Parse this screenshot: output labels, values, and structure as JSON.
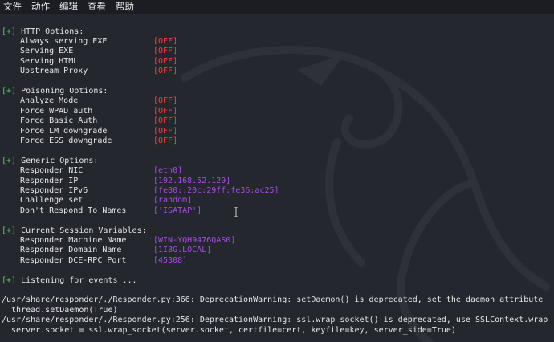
{
  "menu": [
    "文件",
    "动作",
    "编辑",
    "查看",
    "帮助"
  ],
  "tag": "[+]",
  "sections": [
    {
      "title": "HTTP Options:",
      "options": [
        {
          "name": "Always serving EXE",
          "value": "[OFF]",
          "color": "#ff3b3b"
        },
        {
          "name": "Serving EXE",
          "value": "[OFF]",
          "color": "#ff3b3b"
        },
        {
          "name": "Serving HTML",
          "value": "[OFF]",
          "color": "#ff3b3b"
        },
        {
          "name": "Upstream Proxy",
          "value": "[OFF]",
          "color": "#ff3b3b"
        }
      ]
    },
    {
      "title": "Poisoning Options:",
      "options": [
        {
          "name": "Analyze Mode",
          "value": "[OFF]",
          "color": "#ff3b3b"
        },
        {
          "name": "Force WPAD auth",
          "value": "[OFF]",
          "color": "#ff3b3b"
        },
        {
          "name": "Force Basic Auth",
          "value": "[OFF]",
          "color": "#ff3b3b"
        },
        {
          "name": "Force LM downgrade",
          "value": "[OFF]",
          "color": "#ff3b3b"
        },
        {
          "name": "Force ESS downgrade",
          "value": "[OFF]",
          "color": "#ff3b3b"
        }
      ]
    },
    {
      "title": "Generic Options:",
      "options": [
        {
          "name": "Responder NIC",
          "value": "[eth0]",
          "color": "#a54de6"
        },
        {
          "name": "Responder IP",
          "value": "[192.168.52.129]",
          "color": "#a54de6"
        },
        {
          "name": "Responder IPv6",
          "value": "[fe80::20c:29ff:fe36:ac25]",
          "color": "#a54de6"
        },
        {
          "name": "Challenge set",
          "value": "[random]",
          "color": "#a54de6"
        },
        {
          "name": "Don't Respond To Names",
          "value": "['ISATAP']",
          "color": "#a54de6"
        }
      ]
    },
    {
      "title": "Current Session Variables:",
      "options": [
        {
          "name": "Responder Machine Name",
          "value": "[WIN-YQH9476QAS0]",
          "color": "#a54de6"
        },
        {
          "name": "Responder Domain Name",
          "value": "[1I8G.LOCAL]",
          "color": "#a54de6"
        },
        {
          "name": "Responder DCE-RPC Port",
          "value": "[45308]",
          "color": "#a54de6"
        }
      ]
    }
  ],
  "listening": "Listening for events ...",
  "warnings": [
    "/usr/share/responder/./Responder.py:366: DeprecationWarning: setDaemon() is deprecated, set the daemon attribute",
    "  thread.setDaemon(True)",
    "/usr/share/responder/./Responder.py:256: DeprecationWarning: ssl.wrap_socket() is deprecated, use SSLContext.wrap",
    "  server.socket = ssl.wrap_socket(server.socket, certfile=cert, keyfile=key, server_side=True)"
  ]
}
